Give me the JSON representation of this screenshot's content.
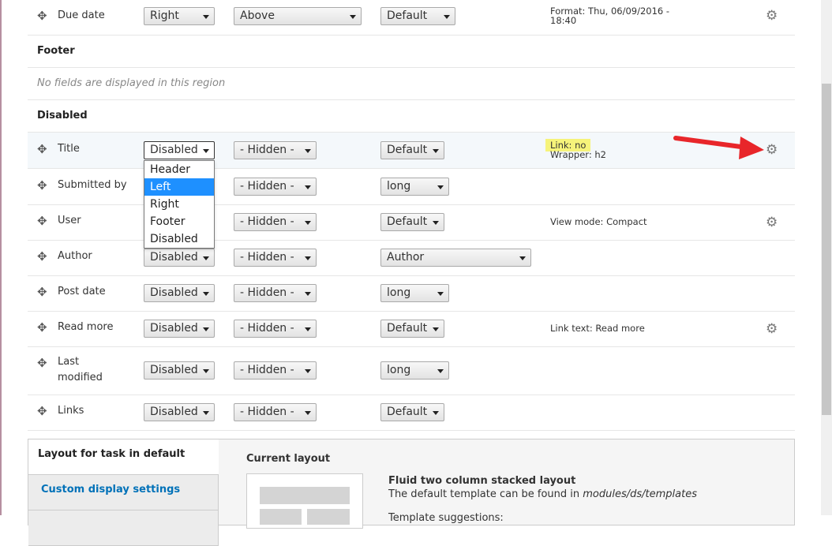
{
  "rows": {
    "due_date": {
      "label": "Due date",
      "region": "Right",
      "label_pos": "Above",
      "formatter": "Default",
      "summary1": "Format: Thu, 06/09/2016 -",
      "summary2": "18:40"
    },
    "footer": {
      "label": "Footer",
      "empty": "No fields are displayed in this region"
    },
    "disabled": {
      "label": "Disabled"
    },
    "title": {
      "label": "Title",
      "region": "Disabled",
      "label_pos": "- Hidden -",
      "formatter": "Default",
      "summary1": "Link: no",
      "summary2": "Wrapper: h2"
    },
    "submitted_by": {
      "label": "Submitted by",
      "label_pos": "- Hidden -",
      "formatter": "long"
    },
    "user": {
      "label": "User",
      "label_pos": "- Hidden -",
      "formatter": "Default",
      "summary1": "View mode: Compact"
    },
    "author": {
      "label": "Author",
      "region": "Disabled",
      "label_pos": "- Hidden -",
      "formatter": "Author"
    },
    "post_date": {
      "label": "Post date",
      "region": "Disabled",
      "label_pos": "- Hidden -",
      "formatter": "long"
    },
    "read_more": {
      "label": "Read more",
      "region": "Disabled",
      "label_pos": "- Hidden -",
      "formatter": "Default",
      "summary1": "Link text: Read more"
    },
    "last_modified": {
      "label1": "Last",
      "label2": "modified",
      "region": "Disabled",
      "label_pos": "- Hidden -",
      "formatter": "long"
    },
    "links": {
      "label": "Links",
      "region": "Disabled",
      "label_pos": "- Hidden -",
      "formatter": "Default"
    }
  },
  "dropdown": {
    "options": [
      "Header",
      "Left",
      "Right",
      "Footer",
      "Disabled"
    ],
    "highlighted": "Left"
  },
  "layout": {
    "tab_active": "Layout for task in default",
    "tab_inactive": "Custom display settings",
    "current_layout": "Current layout",
    "name": "Fluid two column stacked layout",
    "desc_prefix": "The default template can be found in",
    "desc_path": "modules/ds/templates",
    "suggestions": "Template suggestions:"
  },
  "colors": {
    "link": "#0071b8",
    "highlight": "#f6f37a",
    "arrow": "#e8262a",
    "dropdown_active": "#1e90ff"
  },
  "icons": {
    "drag": "drag-handle-icon",
    "gear": "gear-icon",
    "arrow": "red-arrow-annotation"
  }
}
